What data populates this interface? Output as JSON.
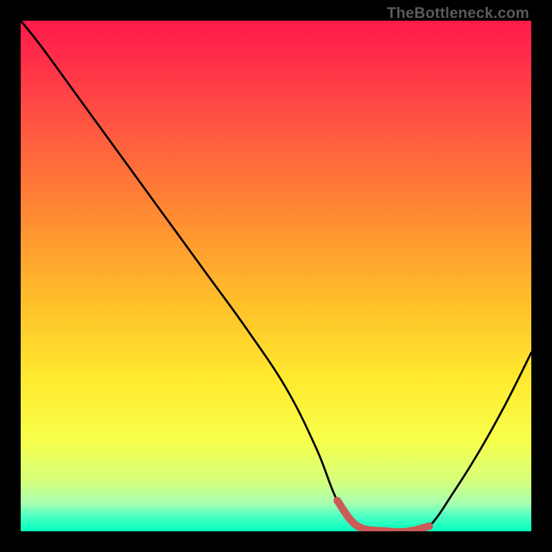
{
  "watermark": "TheBottleneck.com",
  "chart_data": {
    "type": "line",
    "title": "",
    "xlabel": "",
    "ylabel": "",
    "xlim": [
      0,
      100
    ],
    "ylim": [
      0,
      100
    ],
    "series": [
      {
        "name": "bottleneck-curve",
        "x": [
          0,
          4,
          12,
          20,
          28,
          36,
          44,
          52,
          58,
          62,
          66,
          72,
          76,
          80,
          85,
          90,
          95,
          100
        ],
        "y": [
          100,
          95,
          84,
          73,
          62,
          51,
          40,
          28,
          16,
          6,
          1,
          0,
          0,
          1,
          8,
          16,
          25,
          35
        ]
      },
      {
        "name": "optimal-band",
        "x": [
          62,
          66,
          72,
          76,
          80
        ],
        "y": [
          6,
          1,
          0,
          0,
          1
        ]
      }
    ],
    "background_gradient": {
      "stops": [
        {
          "offset": 0.0,
          "color": "#ff1a4b"
        },
        {
          "offset": 0.08,
          "color": "#ff2f49"
        },
        {
          "offset": 0.22,
          "color": "#ff5a40"
        },
        {
          "offset": 0.38,
          "color": "#ff8a32"
        },
        {
          "offset": 0.55,
          "color": "#ffbf2a"
        },
        {
          "offset": 0.7,
          "color": "#ffe92e"
        },
        {
          "offset": 0.82,
          "color": "#f8ff4a"
        },
        {
          "offset": 0.9,
          "color": "#d6ff7a"
        },
        {
          "offset": 0.945,
          "color": "#a8ffb0"
        },
        {
          "offset": 0.97,
          "color": "#4dffc2"
        },
        {
          "offset": 1.0,
          "color": "#00ffbe"
        }
      ]
    },
    "colors": {
      "curve": "#000000",
      "optimal_band": "#cc5a57",
      "frame": "#000000"
    }
  }
}
